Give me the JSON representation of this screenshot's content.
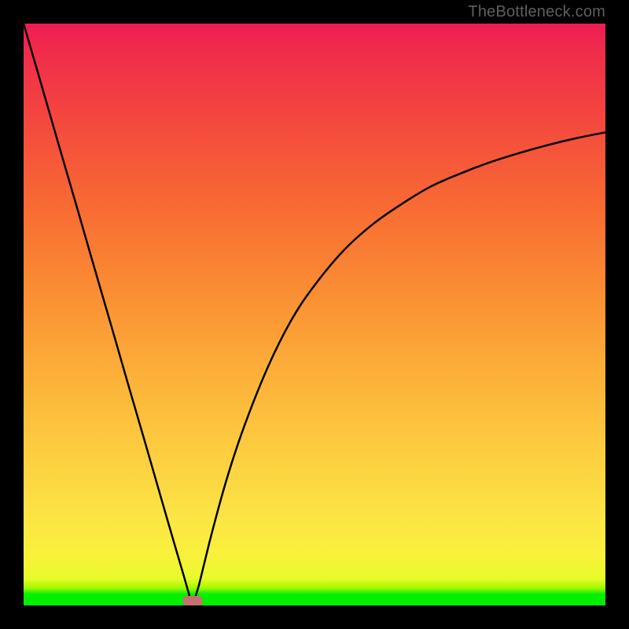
{
  "watermark": "TheBottleneck.com",
  "chart_data": {
    "type": "line",
    "title": "",
    "xlabel": "",
    "ylabel": "",
    "xlim": [
      0,
      100
    ],
    "ylim": [
      0,
      100
    ],
    "grid": false,
    "legend": false,
    "dip_x": 29,
    "series": [
      {
        "name": "left-branch",
        "x": [
          0,
          3,
          6,
          9,
          12,
          15,
          18,
          21,
          24,
          26,
          27.5,
          28.5,
          29
        ],
        "y": [
          100,
          89.7,
          79.3,
          69.0,
          58.6,
          48.3,
          37.9,
          27.6,
          17.2,
          10.3,
          5.2,
          1.7,
          0
        ]
      },
      {
        "name": "right-branch",
        "x": [
          29,
          30,
          31,
          32.5,
          35,
          38,
          42,
          46,
          50,
          55,
          60,
          65,
          70,
          75,
          80,
          85,
          90,
          95,
          100
        ],
        "y": [
          0,
          3,
          7,
          13,
          22,
          31,
          41,
          49,
          55,
          61,
          65.5,
          69,
          72,
          74.2,
          76.1,
          77.7,
          79.1,
          80.3,
          81.3
        ]
      }
    ],
    "background_gradient": {
      "bottom": "#00f000",
      "mid": "#fce545",
      "top": "#ee1c55"
    }
  }
}
